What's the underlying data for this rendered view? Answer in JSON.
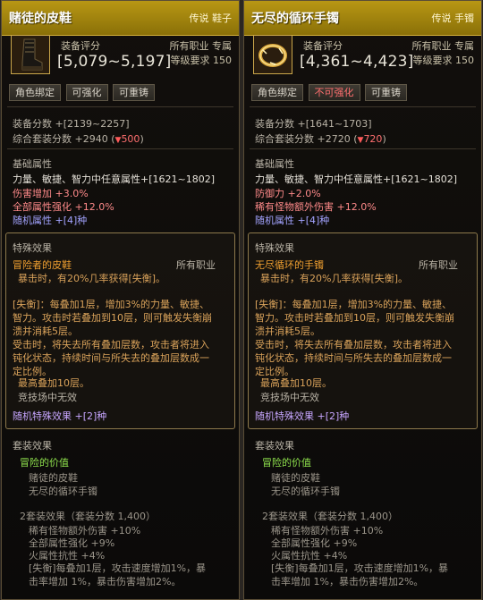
{
  "left": {
    "title": "赌徒的皮鞋",
    "rarity_type": "传说 鞋子",
    "score_label": "装备评分",
    "score_range": "[5,079~5,197]",
    "jobs": "所有职业 专属",
    "level": "等级要求 150",
    "buttons": [
      "角色绑定",
      "可强化",
      "可重铸"
    ],
    "equip_score": "装备分数 +[2139~2257]",
    "set_score": "综合套装分数 +2940",
    "set_score_diff": "500",
    "basic_title": "基础属性",
    "basic_1": "力量、敏捷、智力中任意属性+[1621~1802]",
    "basic_2": "伤害增加 +3.0%",
    "basic_3": "全部属性强化 +12.0%",
    "basic_4": "随机属性 +[4]种",
    "special_title": "特殊效果",
    "special_name": "冒险者的皮鞋",
    "special_job": "所有职业",
    "special_lines": [
      "暴击时，有20%几率获得[失衡]。",
      "[失衡]：每叠加1层，增加3%的力量、敏捷、",
      "智力。攻击时若叠加到10层，则可触发失衡崩",
      "溃并消耗5层。",
      "受击时，将失去所有叠加层数，攻击者将进入",
      "钝化状态，持续时间与所失去的叠加层数成一",
      "定比例。",
      "最高叠加10层。",
      "竞技场中无效"
    ],
    "special_random": "随机特殊效果 +[2]种",
    "set_title": "套装效果",
    "set_name": "冒险的价值",
    "set_items": [
      "赌徒的皮鞋",
      "无尽的循环手镯"
    ],
    "set_bonus_title": "2套装效果（套装分数 1,400）",
    "set_bonus_lines": [
      "稀有怪物额外伤害 +10%",
      "全部属性强化 +9%",
      "火属性抗性 +4%",
      "[失衡]每叠加1层，攻击速度增加1%，暴",
      "击率增加 1%，暴击伤害增加2%。"
    ]
  },
  "right": {
    "title": "无尽的循环手镯",
    "rarity_type": "传说 手镯",
    "score_label": "装备评分",
    "score_range": "[4,361~4,423]",
    "jobs": "所有职业 专属",
    "level": "等级要求 150",
    "buttons": [
      "角色绑定",
      "不可强化",
      "可重铸"
    ],
    "equip_score": "装备分数 +[1641~1703]",
    "set_score": "综合套装分数 +2720",
    "set_score_diff": "720",
    "basic_title": "基础属性",
    "basic_1": "力量、敏捷、智力中任意属性+[1621~1802]",
    "basic_2": "防御力 +2.0%",
    "basic_3": "稀有怪物额外伤害 +12.0%",
    "basic_4": "随机属性 +[4]种",
    "special_title": "特殊效果",
    "special_name": "无尽循环的手镯",
    "special_job": "所有职业",
    "special_lines": [
      "暴击时，有20%几率获得[失衡]。",
      "[失衡]：每叠加1层，增加3%的力量、敏捷、",
      "智力。攻击时若叠加到10层，则可触发失衡崩",
      "溃并消耗5层。",
      "受击时，将失去所有叠加层数，攻击者将进入",
      "钝化状态，持续时间与所失去的叠加层数成一",
      "定比例。",
      "最高叠加10层。",
      "竞技场中无效"
    ],
    "special_random": "随机特殊效果 +[2]种",
    "set_title": "套装效果",
    "set_name": "冒险的价值",
    "set_items": [
      "赌徒的皮鞋",
      "无尽的循环手镯"
    ],
    "set_bonus_title": "2套装效果（套装分数 1,400）",
    "set_bonus_lines": [
      "稀有怪物额外伤害 +10%",
      "全部属性强化 +9%",
      "火属性抗性 +4%",
      "[失衡]每叠加1层，攻击速度增加1%，暴",
      "击率增加 1%，暴击伤害增加2%。"
    ]
  },
  "colors": {
    "header_gold": "#b89714",
    "stat_pink": "#ff8a8a",
    "stat_blue": "#a3a3ff",
    "special_orange": "#f0a030",
    "set_green": "#8ee04d",
    "negative_red": "#ff6f6f"
  },
  "icons": {
    "left_item": "boot-icon",
    "right_item": "ring-bracelet-icon",
    "down_arrow": "down-triangle-icon"
  }
}
